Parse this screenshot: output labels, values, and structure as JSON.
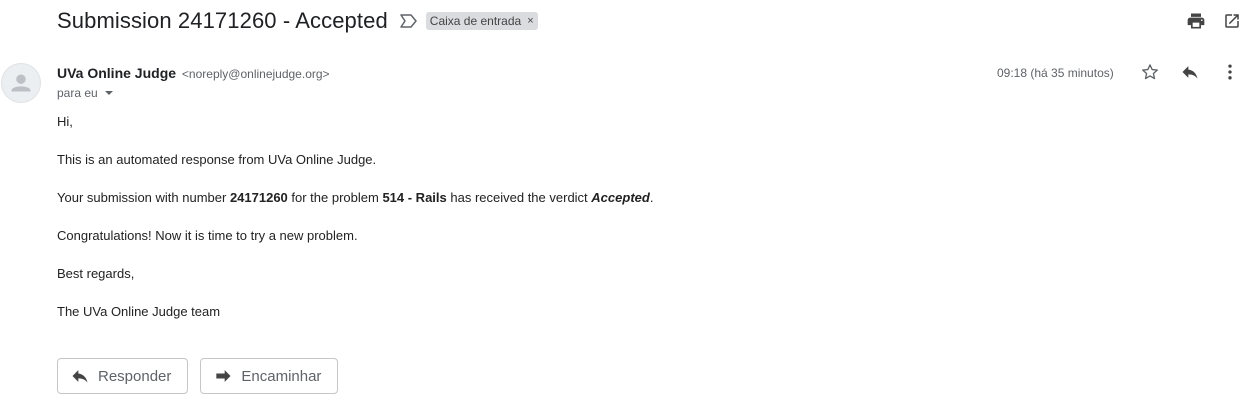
{
  "header": {
    "subject": "Submission 24171260 - Accepted",
    "label": "Caixa de entrada",
    "label_remove": "×",
    "icons": [
      "print-icon",
      "open-in-new-window-icon"
    ]
  },
  "message": {
    "sender_name": "UVa Online Judge",
    "sender_email": "<noreply@onlinejudge.org>",
    "to": "para eu",
    "time": "09:18 (há 35 minutos)",
    "icons": [
      "star-icon",
      "reply-icon",
      "more-vert-icon"
    ],
    "body": {
      "greeting": "Hi,",
      "intro": "This is an automated response from UVa Online Judge.",
      "verdict": {
        "prefix": "Your submission with number ",
        "number": "24171260",
        "middle": " for the problem ",
        "problem": "514 - Rails",
        "suffix": " has received the verdict ",
        "verdict": "Accepted",
        "end": "."
      },
      "congrats": "Congratulations! Now it is time to try a new problem.",
      "regards": "Best regards,",
      "signature": "The UVa Online Judge team"
    }
  },
  "actions": {
    "reply_label": "Responder",
    "forward_label": "Encaminhar"
  }
}
